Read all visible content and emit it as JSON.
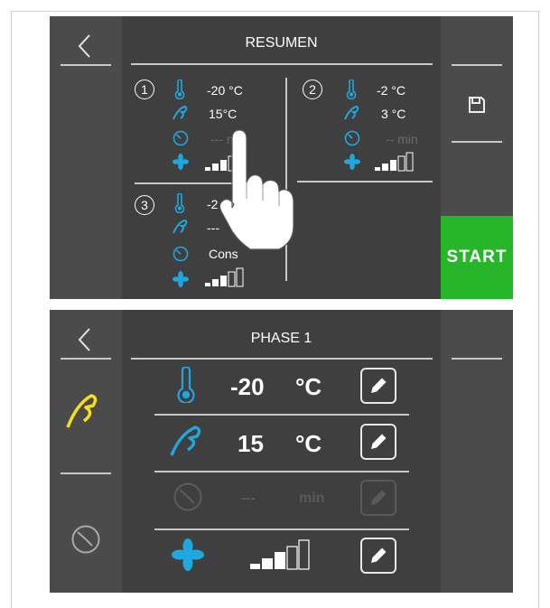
{
  "resumen": {
    "title": "RESUMEN",
    "start_label": "START",
    "phases": [
      {
        "number": "1",
        "temp": "-20 °C",
        "probe": "15°C",
        "time": "--- min"
      },
      {
        "number": "2",
        "temp": "-2 °C",
        "probe": "3 °C",
        "time": "-- min"
      },
      {
        "number": "3",
        "temp": "-2",
        "probe": "---",
        "time": "Cons"
      }
    ]
  },
  "phase": {
    "title": "PHASE 1",
    "temp_value": "-20",
    "temp_unit": "°C",
    "probe_value": "15",
    "probe_unit": "°C",
    "time_value": "---",
    "time_unit": "min"
  },
  "icons": {
    "back": "chevron-left-icon",
    "save": "floppy-disk-icon",
    "thermometer": "thermometer-icon",
    "probe": "core-probe-icon",
    "timer": "timer-icon",
    "fan": "fan-icon",
    "level": "signal-level-icon",
    "edit": "pencil-icon",
    "hand": "hand-pointer-icon"
  },
  "colors": {
    "accent": "#1fa8e0",
    "start": "#27b52a",
    "probe_active": "#f5e11b",
    "panel": "#3f3f3f"
  }
}
